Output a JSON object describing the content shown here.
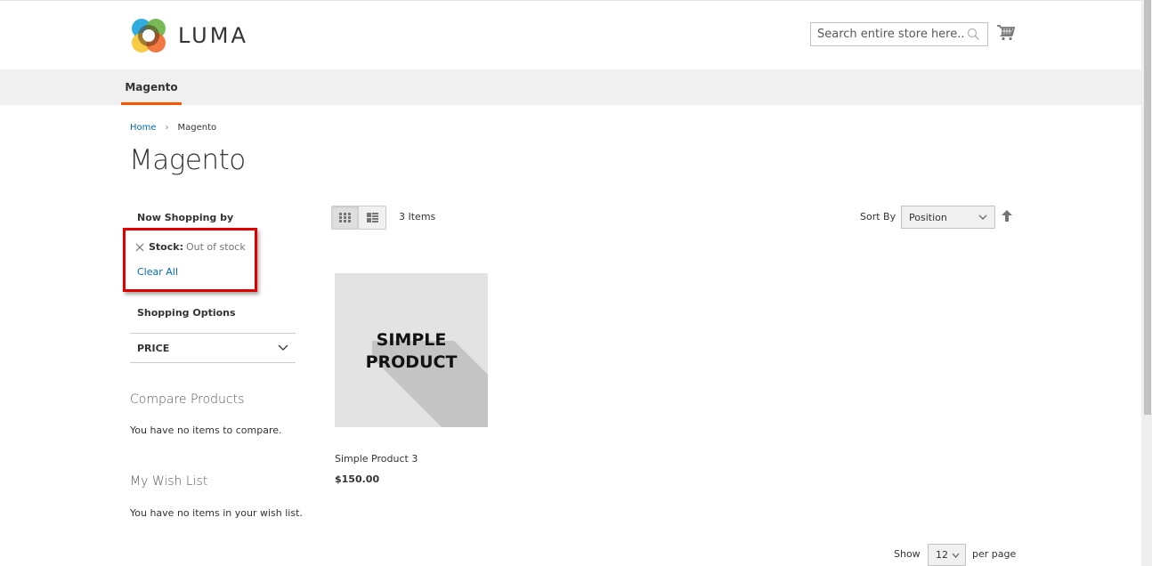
{
  "header": {
    "logo_text": "LUMA",
    "search_placeholder": "Search entire store here...",
    "search_icon": "search-icon",
    "cart_icon": "shopping-cart-icon"
  },
  "nav": {
    "items": [
      {
        "label": "Magento",
        "active": true
      }
    ],
    "accent_color": "#ff5501"
  },
  "breadcrumb": {
    "items": [
      {
        "label": "Home",
        "link": true
      },
      {
        "label": "Magento",
        "link": false
      }
    ],
    "separator_icon": "chevron-right-icon"
  },
  "page_title": "Magento",
  "sidebar": {
    "now_shopping_title": "Now Shopping by",
    "active_filters": [
      {
        "label": "Stock:",
        "value": "Out of stock",
        "remove_icon": "close-icon"
      }
    ],
    "clear_all": "Clear All",
    "shopping_options_title": "Shopping Options",
    "filters": [
      {
        "label": "PRICE",
        "icon": "chevron-down-icon"
      }
    ],
    "compare": {
      "title": "Compare Products",
      "text": "You have no items to compare."
    },
    "wishlist": {
      "title": "My Wish List",
      "text": "You have no items in your wish list."
    },
    "highlight_color": "#e10000"
  },
  "toolbar": {
    "modes": [
      {
        "name": "grid",
        "icon": "grid-icon",
        "active": true
      },
      {
        "name": "list",
        "icon": "list-icon",
        "active": false
      }
    ],
    "items_count": "3 Items",
    "sort_label": "Sort By",
    "sort_value": "Position",
    "sort_direction_icon": "arrow-up-icon"
  },
  "products": [
    {
      "name": "Simple Product 3",
      "price": "$150.00",
      "image_text_line1": "SIMPLE",
      "image_text_line2": "PRODUCT"
    }
  ],
  "limiter": {
    "label": "Show",
    "value": "12",
    "suffix": "per page"
  },
  "colors": {
    "link": "#006bb4",
    "accent": "#ff5501",
    "highlight": "#e10000"
  }
}
